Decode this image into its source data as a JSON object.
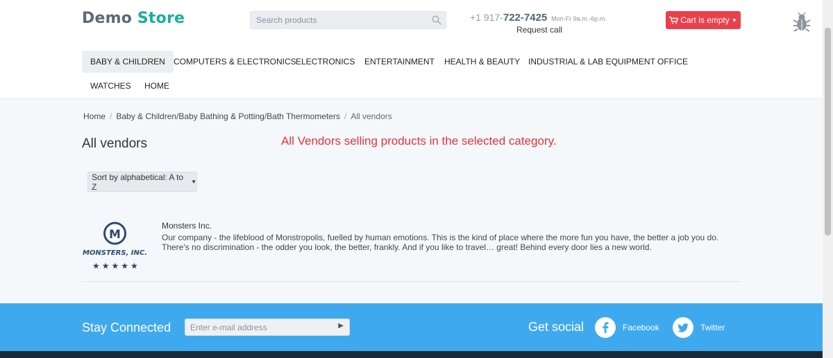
{
  "header": {
    "logo_part1": "Demo",
    "logo_part2": "Store",
    "search_placeholder": "Search products",
    "phone_prefix": "+1 917-",
    "phone_number": "722-7425",
    "phone_hours": "Mon-Fr 9a.m.-6p.m.",
    "request_call": "Request call",
    "cart_label": "Cart is empty",
    "accent_color": "#e8414c",
    "brand_color": "#18b09a"
  },
  "nav": {
    "items": [
      {
        "label": "Baby & Children",
        "active": true
      },
      {
        "label": "Computers & Electronics"
      },
      {
        "label": "Electronics"
      },
      {
        "label": "Entertainment"
      },
      {
        "label": "Health & Beauty"
      },
      {
        "label": "Industrial & Lab Equipment"
      },
      {
        "label": "Office"
      },
      {
        "label": "Watches"
      },
      {
        "label": "Home"
      }
    ]
  },
  "breadcrumb": {
    "home": "Home",
    "category": "Baby & Children/Baby Bathing & Potting/Bath Thermometers",
    "current": "All vendors"
  },
  "main": {
    "title": "All vendors",
    "notice": "All Vendors selling products in the selected category.",
    "sort_label": "Sort by alphabetical: A to Z"
  },
  "vendors": [
    {
      "name": "Monsters Inc.",
      "logo_text": "MONSTERS, INC.",
      "logo_mark": "M",
      "rating": 5,
      "stars": "★★★★★",
      "description": "Our company - the lifeblood of Monstropolis, fuelled by human emotions. This is the kind of place where the more fun you have, the better a job you do. There's no discrimination - the odder you look, the better, frankly. And if you like to travel… great! Behind every door lies a new world."
    }
  ],
  "footer": {
    "stay_connected": "Stay Connected",
    "email_placeholder": "Enter e-mail address",
    "get_social": "Get social",
    "facebook": "Facebook",
    "twitter": "Twitter",
    "footer_color": "#3fa9ef"
  }
}
